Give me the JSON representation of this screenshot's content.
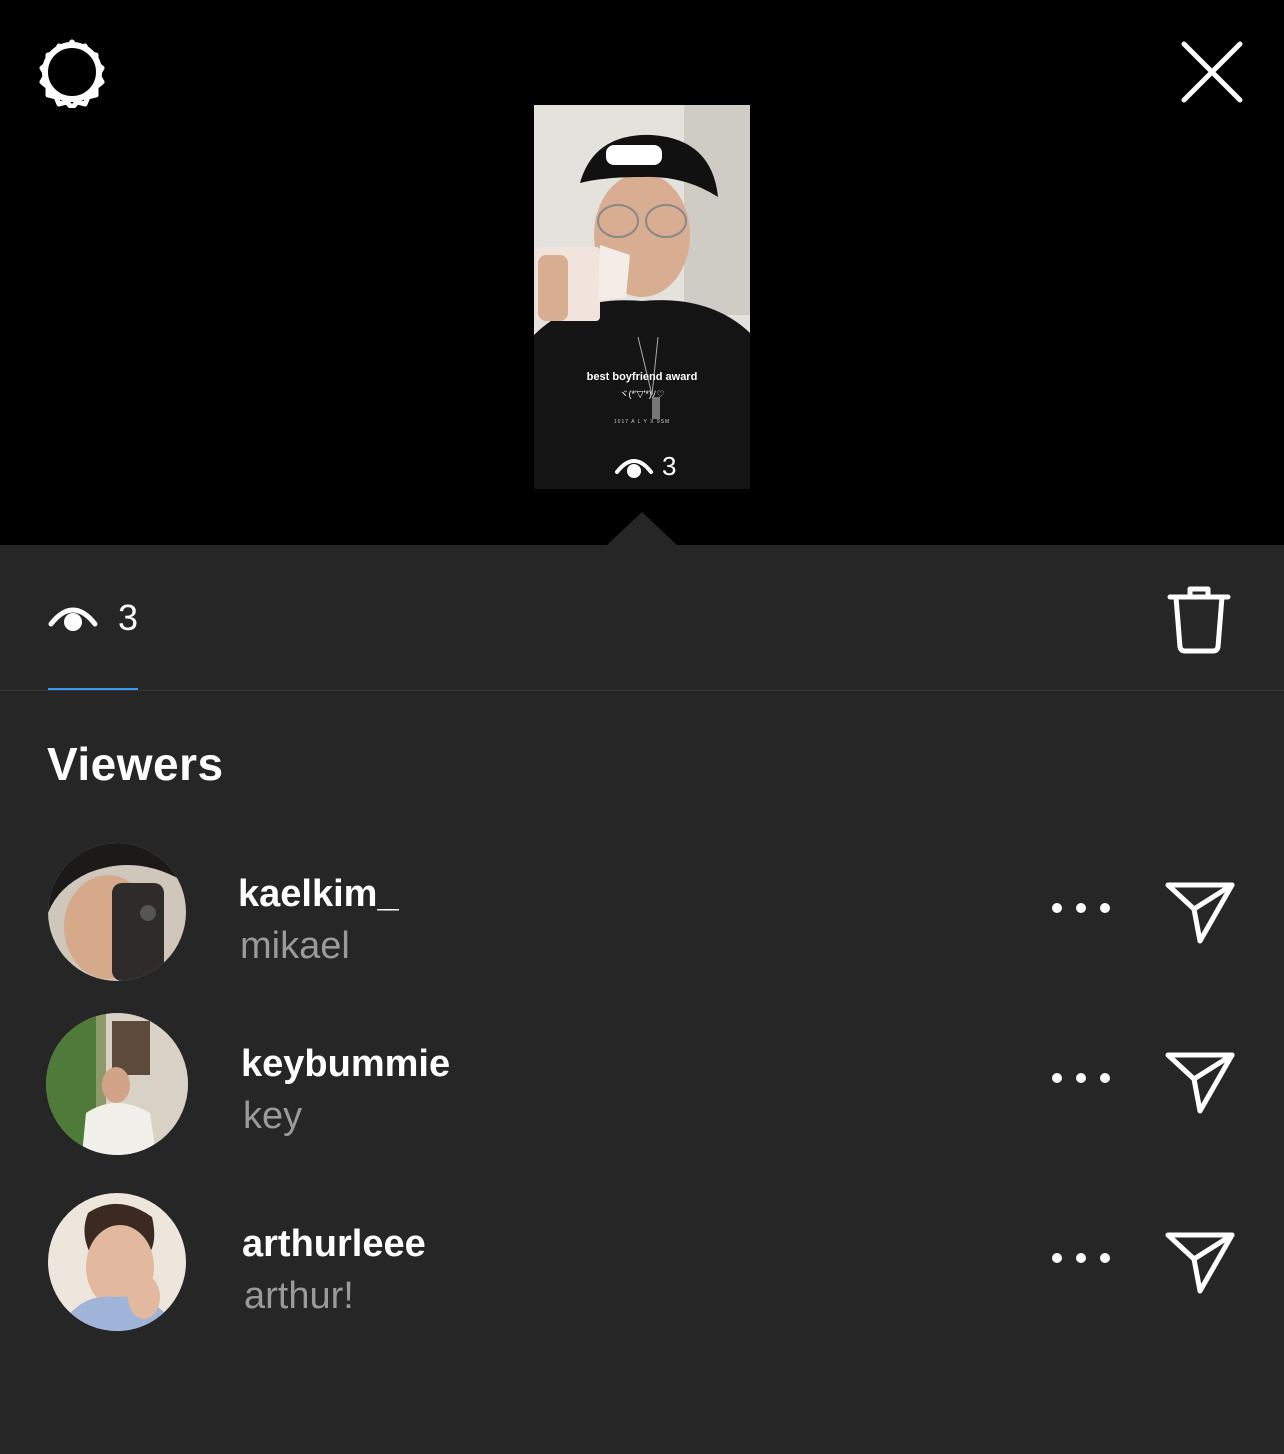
{
  "icons": {
    "settings": "gear-icon",
    "close": "close-icon",
    "views": "eye-icon",
    "delete": "trash-icon",
    "more": "more-dots-icon",
    "send": "send-icon"
  },
  "story": {
    "caption": "best boyfriend award",
    "emoticon": "ヾ(*'▽'*)ﾉ♡",
    "shirt_text": "1017 A L Y X 9SM",
    "view_count": "3"
  },
  "tabbar": {
    "view_count": "3"
  },
  "viewers_title": "Viewers",
  "viewers": [
    {
      "username": "kaelkim_",
      "full_name": "mikael"
    },
    {
      "username": "keybummie",
      "full_name": "key"
    },
    {
      "username": "arthurleee",
      "full_name": "arthur!"
    }
  ],
  "colors": {
    "sheet": "#262626",
    "accent": "#3897f0",
    "secondary_text": "#9a9a9a"
  }
}
